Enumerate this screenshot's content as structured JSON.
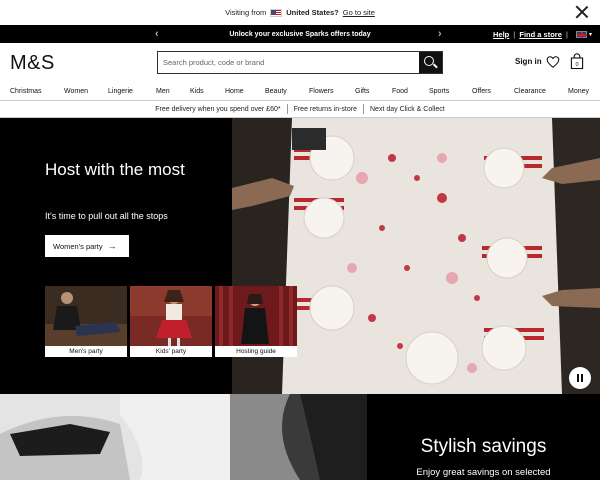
{
  "visit_banner": {
    "prefix": "Visiting from",
    "country": "United States?",
    "link": "Go to site"
  },
  "promo": {
    "message": "Unlock your exclusive Sparks offers today",
    "help": "Help",
    "separator": "|",
    "find_store": "Find a store"
  },
  "header": {
    "logo": "M&S",
    "search_placeholder": "Search product, code or brand",
    "sign_in": "Sign in",
    "bag_count": "0"
  },
  "nav": {
    "items": [
      "Christmas",
      "Women",
      "Lingerie",
      "Men",
      "Kids",
      "Home",
      "Beauty",
      "Flowers",
      "Gifts",
      "Food",
      "Sports",
      "Offers",
      "Clearance",
      "Money"
    ]
  },
  "usp": {
    "items": [
      "Free delivery when you spend over £60*",
      "Free returns in-store",
      "Next day Click & Collect"
    ]
  },
  "hero": {
    "title": "Host with the most",
    "subtitle": "It's time to pull out all the stops",
    "cta": "Women's party",
    "tiles": [
      "Men's party",
      "Kids' party",
      "Hosting guide"
    ]
  },
  "bottom": {
    "title": "Stylish savings",
    "subtitle": "Enjoy great savings on selected"
  },
  "colors": {
    "black": "#000000",
    "white": "#ffffff",
    "table_red": "#b8282d"
  }
}
